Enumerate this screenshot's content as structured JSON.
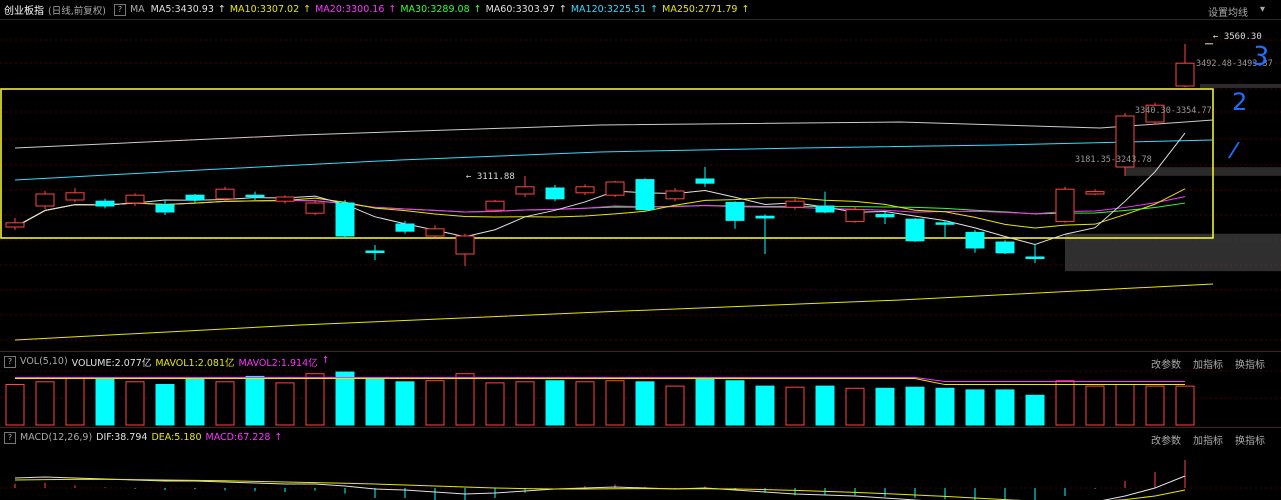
{
  "header": {
    "index_name": "创业板指",
    "period": "(日线,前复权)",
    "help": "?",
    "ma_label": "MA",
    "ma_items": [
      {
        "text": "MA5:3430.93",
        "color": "#e0e0e0"
      },
      {
        "text": "MA10:3307.02",
        "color": "#e8e800"
      },
      {
        "text": "MA20:3300.16",
        "color": "#ff33ff"
      },
      {
        "text": "MA30:3289.08",
        "color": "#33ff33"
      },
      {
        "text": "MA60:3303.97",
        "color": "#e0e0e0"
      },
      {
        "text": "MA120:3225.51",
        "color": "#33ddff"
      },
      {
        "text": "MA250:2771.79",
        "color": "#e8e800"
      }
    ],
    "settings": "设置均线"
  },
  "annotations": {
    "high": "3560.30",
    "low": "3111.88",
    "gap_upper": "3492.48-3493.37",
    "gap_mid": "3340.30-3354.77",
    "gap_lower": "3181.35-3243.78",
    "hand_marks": [
      "3",
      "2",
      "/"
    ]
  },
  "vol_header": {
    "label": "VOL(5,10)",
    "items": [
      {
        "text": "VOLUME:2.077亿",
        "color": "#e0e0e0"
      },
      {
        "text": "MAVOL1:2.081亿",
        "color": "#e8e800"
      },
      {
        "text": "MAVOL2:1.914亿",
        "color": "#ff33ff"
      }
    ]
  },
  "macd_header": {
    "label": "MACD(12,26,9)",
    "items": [
      {
        "text": "DIF:38.794",
        "color": "#e0e0e0"
      },
      {
        "text": "DEA:5.180",
        "color": "#e8e800"
      },
      {
        "text": "MACD:67.228",
        "color": "#ff33ff"
      }
    ]
  },
  "tools": [
    "改参数",
    "加指标",
    "换指标"
  ],
  "colors": {
    "up": "#ff4444",
    "down": "#00ffff",
    "box": "#ffff33",
    "hand": "#1e6fff"
  },
  "chart_data": {
    "type": "candlestick",
    "price_range": [
      3050,
      3600
    ],
    "candles": [
      {
        "o": 3262,
        "c": 3255,
        "h": 3270,
        "l": 3250,
        "up": true
      },
      {
        "o": 3290,
        "c": 3310,
        "h": 3315,
        "l": 3285,
        "up": true
      },
      {
        "o": 3300,
        "c": 3312,
        "h": 3320,
        "l": 3296,
        "up": true
      },
      {
        "o": 3298,
        "c": 3290,
        "h": 3302,
        "l": 3286,
        "up": false
      },
      {
        "o": 3295,
        "c": 3308,
        "h": 3311,
        "l": 3290,
        "up": true
      },
      {
        "o": 3292,
        "c": 3280,
        "h": 3300,
        "l": 3275,
        "up": false
      },
      {
        "o": 3300,
        "c": 3308,
        "h": 3310,
        "l": 3295,
        "up": false
      },
      {
        "o": 3302,
        "c": 3318,
        "h": 3322,
        "l": 3298,
        "up": true
      },
      {
        "o": 3308,
        "c": 3306,
        "h": 3314,
        "l": 3300,
        "up": false
      },
      {
        "o": 3298,
        "c": 3305,
        "h": 3308,
        "l": 3294,
        "up": true
      },
      {
        "o": 3278,
        "c": 3295,
        "h": 3298,
        "l": 3275,
        "up": true
      },
      {
        "o": 3295,
        "c": 3240,
        "h": 3300,
        "l": 3235,
        "up": false
      },
      {
        "o": 3215,
        "c": 3214,
        "h": 3225,
        "l": 3200,
        "up": false
      },
      {
        "o": 3260,
        "c": 3248,
        "h": 3265,
        "l": 3244,
        "up": false
      },
      {
        "o": 3240,
        "c": 3252,
        "h": 3258,
        "l": 3238,
        "up": true
      },
      {
        "o": 3210,
        "c": 3240,
        "h": 3244,
        "l": 3190,
        "up": true
      },
      {
        "o": 3283,
        "c": 3298,
        "h": 3300,
        "l": 3280,
        "up": true
      },
      {
        "o": 3310,
        "c": 3322,
        "h": 3340,
        "l": 3305,
        "up": true
      },
      {
        "o": 3320,
        "c": 3302,
        "h": 3325,
        "l": 3298,
        "up": false
      },
      {
        "o": 3312,
        "c": 3322,
        "h": 3326,
        "l": 3308,
        "up": true
      },
      {
        "o": 3308,
        "c": 3330,
        "h": 3332,
        "l": 3305,
        "up": true
      },
      {
        "o": 3334,
        "c": 3284,
        "h": 3336,
        "l": 3282,
        "up": false
      },
      {
        "o": 3302,
        "c": 3315,
        "h": 3320,
        "l": 3298,
        "up": true
      },
      {
        "o": 3335,
        "c": 3328,
        "h": 3355,
        "l": 3322,
        "up": false
      },
      {
        "o": 3296,
        "c": 3266,
        "h": 3298,
        "l": 3252,
        "up": false
      },
      {
        "o": 3273,
        "c": 3270,
        "h": 3276,
        "l": 3210,
        "up": false
      },
      {
        "o": 3288,
        "c": 3298,
        "h": 3302,
        "l": 3284,
        "up": true
      },
      {
        "o": 3290,
        "c": 3280,
        "h": 3314,
        "l": 3278,
        "up": false
      },
      {
        "o": 3264,
        "c": 3284,
        "h": 3290,
        "l": 3262,
        "up": true
      },
      {
        "o": 3276,
        "c": 3272,
        "h": 3280,
        "l": 3260,
        "up": false
      },
      {
        "o": 3268,
        "c": 3232,
        "h": 3270,
        "l": 3230,
        "up": false
      },
      {
        "o": 3262,
        "c": 3260,
        "h": 3266,
        "l": 3236,
        "up": false
      },
      {
        "o": 3246,
        "c": 3220,
        "h": 3250,
        "l": 3212,
        "up": false
      },
      {
        "o": 3230,
        "c": 3212,
        "h": 3233,
        "l": 3210,
        "up": false
      },
      {
        "o": 3205,
        "c": 3205,
        "h": 3226,
        "l": 3195,
        "up": false
      },
      {
        "o": 3264,
        "c": 3318,
        "h": 3322,
        "l": 3262,
        "up": true
      },
      {
        "o": 3310,
        "c": 3314,
        "h": 3318,
        "l": 3308,
        "up": true
      },
      {
        "o": 3355,
        "c": 3440,
        "h": 3445,
        "l": 3340,
        "up": true
      },
      {
        "o": 3430,
        "c": 3458,
        "h": 3462,
        "l": 3426,
        "up": true
      },
      {
        "o": 3490,
        "c": 3528,
        "h": 3560,
        "l": 3488,
        "up": true
      }
    ],
    "volume": [
      0.75,
      0.8,
      0.88,
      0.85,
      0.8,
      0.75,
      0.85,
      0.8,
      0.9,
      0.78,
      0.95,
      0.98,
      0.85,
      0.8,
      0.82,
      0.95,
      0.78,
      0.8,
      0.82,
      0.8,
      0.82,
      0.8,
      0.72,
      0.88,
      0.82,
      0.72,
      0.7,
      0.72,
      0.68,
      0.68,
      0.7,
      0.68,
      0.65,
      0.65,
      0.55,
      0.82,
      0.72,
      0.75,
      0.72,
      0.72
    ],
    "volume_up": [
      true,
      true,
      true,
      false,
      true,
      false,
      false,
      true,
      false,
      true,
      true,
      false,
      false,
      false,
      true,
      true,
      true,
      true,
      false,
      true,
      true,
      false,
      true,
      false,
      false,
      false,
      true,
      false,
      true,
      false,
      false,
      false,
      false,
      false,
      false,
      true,
      true,
      true,
      true,
      true
    ],
    "macd_dif": [
      0.5,
      0.55,
      0.5,
      0.45,
      0.4,
      0.35,
      0.35,
      0.3,
      0.25,
      0.2,
      0.2,
      0.1,
      -0.05,
      -0.1,
      -0.2,
      -0.3,
      -0.25,
      -0.15,
      -0.05,
      0.0,
      0.05,
      0.0,
      -0.05,
      0.0,
      -0.1,
      -0.2,
      -0.3,
      -0.35,
      -0.4,
      -0.5,
      -0.6,
      -0.7,
      -0.8,
      -0.9,
      -1.0,
      -0.9,
      -0.7,
      -0.4,
      0.0,
      0.6
    ],
    "macd_dea": [
      0.4,
      0.42,
      0.43,
      0.43,
      0.42,
      0.4,
      0.38,
      0.36,
      0.33,
      0.3,
      0.27,
      0.24,
      0.2,
      0.15,
      0.1,
      0.05,
      0.0,
      -0.03,
      -0.05,
      -0.05,
      -0.04,
      -0.03,
      -0.04,
      -0.04,
      -0.05,
      -0.08,
      -0.12,
      -0.17,
      -0.22,
      -0.28,
      -0.35,
      -0.42,
      -0.5,
      -0.58,
      -0.66,
      -0.7,
      -0.68,
      -0.58,
      -0.4,
      -0.1
    ]
  }
}
